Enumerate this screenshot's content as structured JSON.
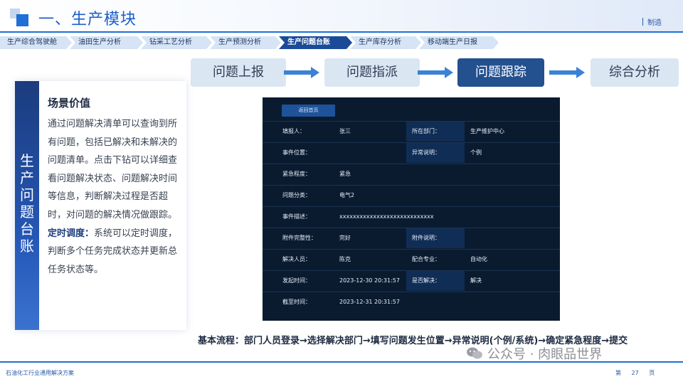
{
  "header": {
    "title": "一、生产模块",
    "brand": "制造"
  },
  "tabs": [
    {
      "label": "生产综合驾驶舱",
      "active": false
    },
    {
      "label": "油田生产分析",
      "active": false
    },
    {
      "label": "钻采工艺分析",
      "active": false
    },
    {
      "label": "生产预测分析",
      "active": false
    },
    {
      "label": "生产问题台账",
      "active": true
    },
    {
      "label": "生产库存分析",
      "active": false
    },
    {
      "label": "移动端生产日报",
      "active": false
    }
  ],
  "steps": [
    {
      "label": "问题上报",
      "active": false
    },
    {
      "label": "问题指派",
      "active": false
    },
    {
      "label": "问题跟踪",
      "active": true
    },
    {
      "label": "综合分析",
      "active": false
    }
  ],
  "panel": {
    "side_title": [
      "生",
      "产",
      "问",
      "题",
      "台",
      "账"
    ],
    "heading": "场景价值",
    "body_part1": "通过问题解决清单可以查询到所有问题，包括已解决和未解决的问题清单。点击下钻可以详细查看问题解决状态、问题解决时间等信息，判断解决过程是否超时，对问题的解决情况做跟踪。",
    "body_bold": "定时调度：",
    "body_part2": "系统可以定时调度，判断多个任务完成状态并更新总任务状态等。"
  },
  "form": {
    "back_button": "返回首页",
    "rows": [
      {
        "label1": "填报人：",
        "value1": "张三",
        "label2": "所在部门：",
        "value2": "生产维护中心"
      },
      {
        "label1": "事件位置：",
        "value1": "",
        "label2": "异常说明：",
        "value2": "个例"
      },
      {
        "label1": "紧急程度：",
        "value1": "紧急"
      },
      {
        "label1": "问题分类：",
        "value1": "电气2"
      },
      {
        "label1": "事件描述：",
        "value1": "xxxxxxxxxxxxxxxxxxxxxxxxxxxx"
      },
      {
        "label1": "附件完整性：",
        "value1": "完好",
        "label2": "附件说明：",
        "value2": ""
      },
      {
        "label1": "解决人员：",
        "value1": "陈克",
        "label2": "配合专业：",
        "value2": "自动化"
      },
      {
        "label1": "发起时间：",
        "value1": "2023-12-30  20:31:57",
        "label2": "是否解决：",
        "value2": "解决"
      },
      {
        "label1": "截至时间：",
        "value1": "2023-12-31  20:31:57"
      }
    ]
  },
  "flow_text": "基本流程：部门人员登录→选择解决部门→填写问题发生位置→异常说明(个例/系统)→确定紧急程度→提交",
  "watermark": "公众号 · 肉眼品世界",
  "footer": {
    "left": "石油化工行业通用解决方案",
    "page_prefix": "第",
    "page_number": "27",
    "page_suffix": "页"
  }
}
